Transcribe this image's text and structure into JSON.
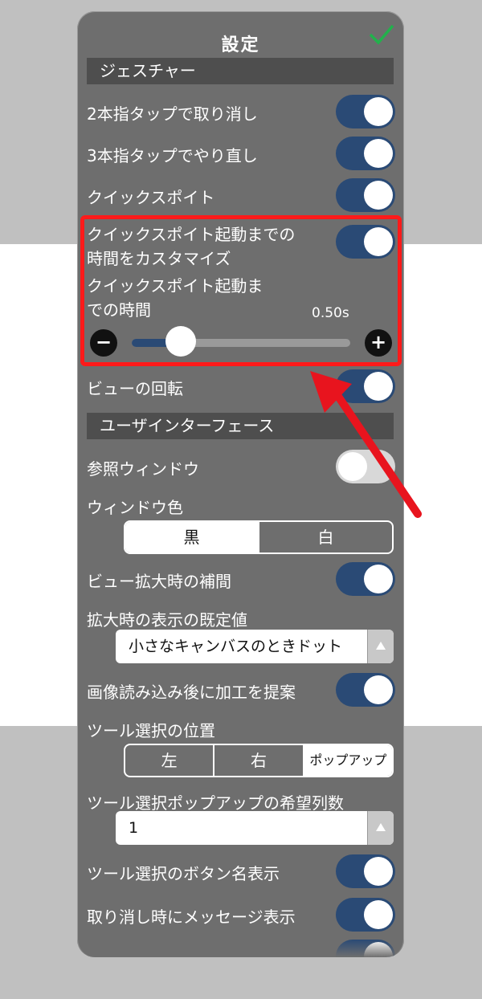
{
  "title": "設定",
  "sections": {
    "gesture": "ジェスチャー",
    "ui": "ユーザインターフェース"
  },
  "gesture": {
    "two_finger_undo": "2本指タップで取り消し",
    "three_finger_redo": "3本指タップでやり直し",
    "quick_eyedropper": "クイックスポイト",
    "custom_time_line1": "クイックスポイト起動までの",
    "custom_time_line2": "時間をカスタマイズ",
    "time_label_line1": "クイックスポイト起動ま",
    "time_label_line2": "での時間",
    "time_value": "0.50s",
    "time_fraction": 0.2,
    "minus": "−",
    "plus": "+",
    "view_rotation": "ビューの回転"
  },
  "ui": {
    "reference_window": "参照ウィンドウ",
    "window_color": "ウィンドウ色",
    "window_color_options": [
      "黒",
      "白"
    ],
    "window_color_selected": "黒",
    "zoom_interp": "ビュー拡大時の補間",
    "zoom_default": "拡大時の表示の既定値",
    "zoom_default_value": "小さなキャンバスのときドット",
    "suggest_after_load": "画像読み込み後に加工を提案",
    "tool_position": "ツール選択の位置",
    "tool_position_options": [
      "左",
      "右",
      "ポップアップ"
    ],
    "tool_position_selected": "ポップアップ",
    "tool_columns": "ツール選択ポップアップの希望列数",
    "tool_columns_value": "1",
    "tool_button_names": "ツール選択のボタン名表示",
    "undo_message": "取り消し時にメッセージ表示"
  },
  "toggles": {
    "two_finger_undo": true,
    "three_finger_redo": true,
    "quick_eyedropper": true,
    "custom_time": true,
    "view_rotation": true,
    "reference_window": false,
    "zoom_interp": true,
    "suggest_after_load": true,
    "tool_button_names": true,
    "undo_message": true
  },
  "colors": {
    "accent": "#2a4a75",
    "panel": "#6e6e6e",
    "highlight": "#ff1a1a",
    "check": "#22b14c"
  }
}
